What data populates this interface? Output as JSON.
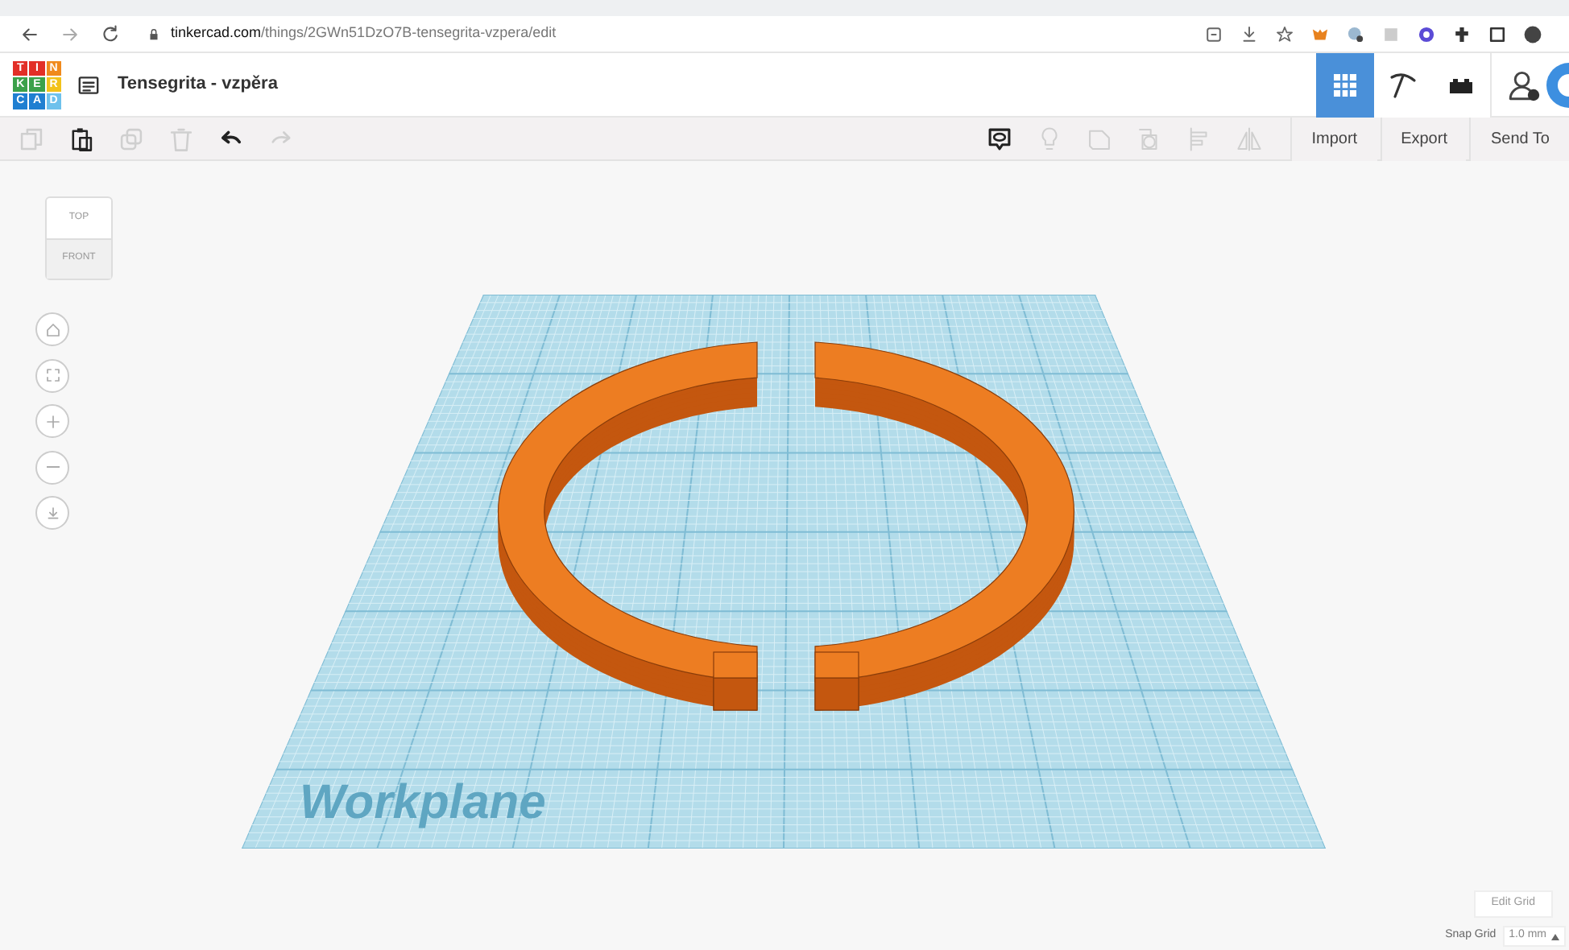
{
  "browser": {
    "url_host": "tinkercad.com",
    "url_path": "/things/2GWn51DzO7B-tensegrita-vzpera/edit"
  },
  "app": {
    "logo": [
      "T",
      "I",
      "N",
      "K",
      "E",
      "R",
      "C",
      "A",
      "D"
    ],
    "title": "Tensegrita - vzpěra",
    "views": [
      {
        "kind": "grid",
        "selected": true
      },
      {
        "kind": "pickaxe",
        "selected": false
      },
      {
        "kind": "bricks",
        "selected": false
      }
    ]
  },
  "toolbar": {
    "left": [
      {
        "kind": "copy",
        "disabled": true
      },
      {
        "kind": "paste",
        "disabled": false
      },
      {
        "kind": "duplicate",
        "disabled": true
      },
      {
        "kind": "delete",
        "disabled": true
      },
      {
        "kind": "undo",
        "disabled": false
      },
      {
        "kind": "redo",
        "disabled": true
      }
    ],
    "right": [
      {
        "kind": "note",
        "disabled": false
      },
      {
        "kind": "bulb",
        "disabled": true
      },
      {
        "kind": "group",
        "disabled": true
      },
      {
        "kind": "ungroup",
        "disabled": true
      },
      {
        "kind": "align",
        "disabled": true
      },
      {
        "kind": "mirror",
        "disabled": true
      }
    ],
    "actions": [
      "Import",
      "Export",
      "Send To"
    ]
  },
  "view_cube": {
    "top": "TOP",
    "front": "FRONT"
  },
  "workplane": {
    "label": "Workplane"
  },
  "grid": {
    "edit": "Edit Grid",
    "snap_label": "Snap Grid",
    "snap_value": "1.0 mm"
  }
}
